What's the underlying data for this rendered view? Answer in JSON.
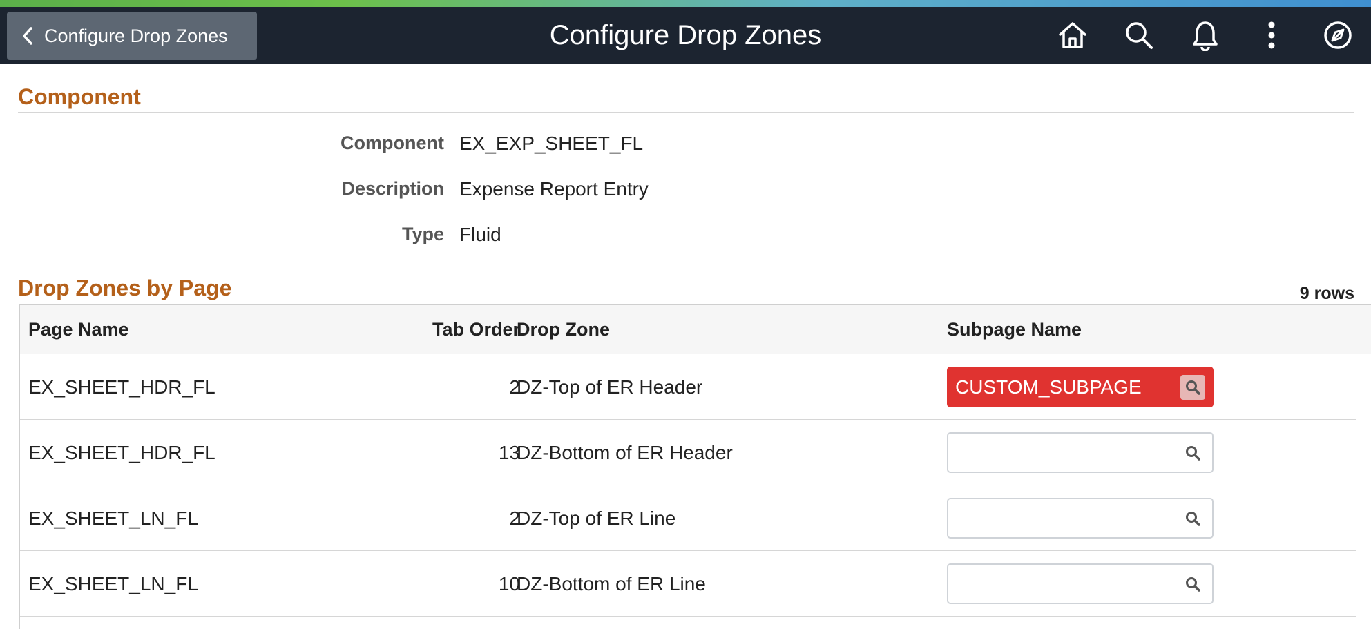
{
  "header": {
    "back_label": "Configure Drop Zones",
    "title": "Configure Drop Zones",
    "icons": [
      "home-icon",
      "search-icon",
      "bell-icon",
      "more-vertical-icon",
      "compass-icon"
    ]
  },
  "component_section": {
    "title": "Component",
    "fields": [
      {
        "label": "Component",
        "value": "EX_EXP_SHEET_FL"
      },
      {
        "label": "Description",
        "value": "Expense Report Entry"
      },
      {
        "label": "Type",
        "value": "Fluid"
      }
    ]
  },
  "dropzones_section": {
    "title": "Drop Zones by Page",
    "rows_count": "9 rows",
    "columns": [
      "Page Name",
      "Tab Order",
      "Drop Zone",
      "Subpage Name"
    ],
    "rows": [
      {
        "page_name": "EX_SHEET_HDR_FL",
        "tab_order": "2",
        "drop_zone": "DZ-Top of ER Header",
        "subpage": "CUSTOM_SUBPAGE"
      },
      {
        "page_name": "EX_SHEET_HDR_FL",
        "tab_order": "13",
        "drop_zone": "DZ-Bottom of ER Header",
        "subpage": ""
      },
      {
        "page_name": "EX_SHEET_LN_FL",
        "tab_order": "2",
        "drop_zone": "DZ-Top of ER Line",
        "subpage": ""
      },
      {
        "page_name": "EX_SHEET_LN_FL",
        "tab_order": "10",
        "drop_zone": "DZ-Bottom of ER Line",
        "subpage": ""
      }
    ]
  },
  "colors": {
    "header_bg": "#1c2430",
    "section_title": "#b4601a",
    "error_field": "#e03330"
  }
}
